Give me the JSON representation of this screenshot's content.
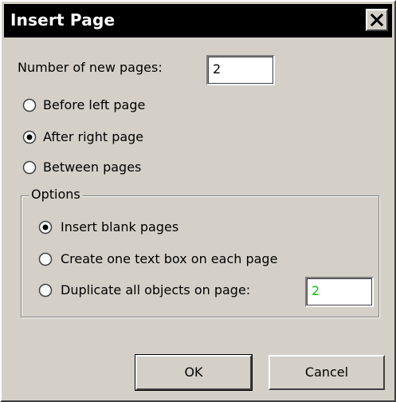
{
  "dialog": {
    "title": "Insert Page",
    "close_icon": "close-x-icon"
  },
  "pages": {
    "label": "Number of new pages:",
    "value": "2"
  },
  "placement": {
    "selected": "after-right-page",
    "options": [
      {
        "label": "Before left page",
        "checked": false
      },
      {
        "label": "After right page",
        "checked": true
      },
      {
        "label": "Between pages",
        "checked": false
      }
    ]
  },
  "options_group": {
    "title": "Options",
    "selected": "insert-blank-pages",
    "items": [
      {
        "label": "Insert blank pages",
        "checked": true
      },
      {
        "label": "Create one text box on each page",
        "checked": false
      },
      {
        "label": "Duplicate all objects on page:",
        "checked": false
      }
    ],
    "duplicate_page_value": "2",
    "duplicate_value_color": "#00cc00"
  },
  "buttons": {
    "ok": "OK",
    "cancel": "Cancel"
  }
}
